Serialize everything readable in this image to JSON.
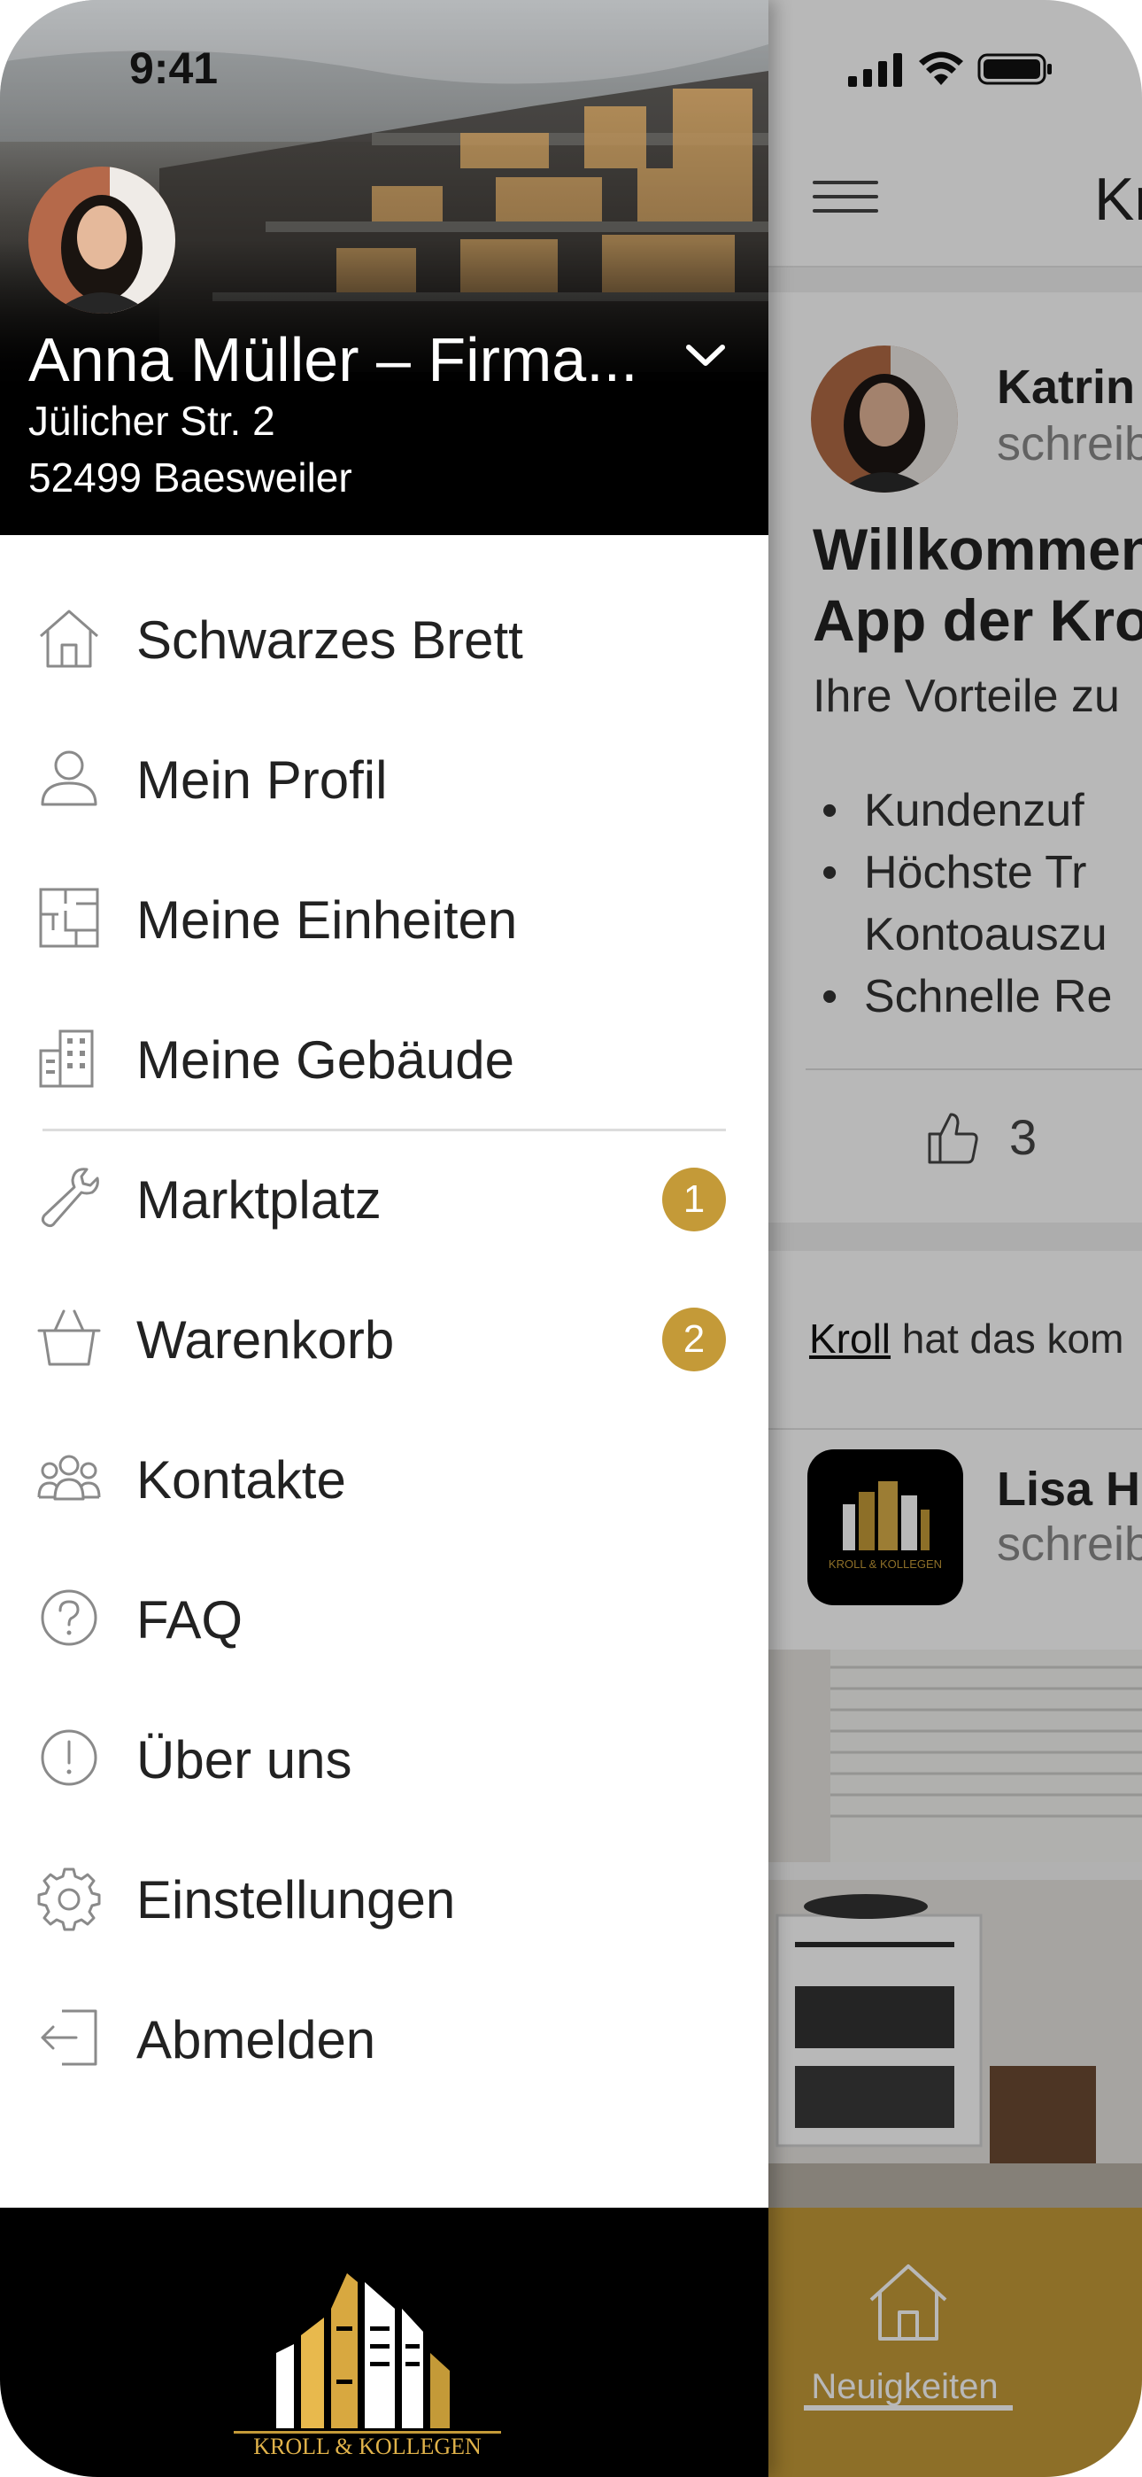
{
  "status_bar": {
    "time": "9:41"
  },
  "profile": {
    "name": "Anna Müller – Firma...",
    "street": "Jülicher Str. 2",
    "city": "52499 Baesweiler"
  },
  "menu": {
    "items": [
      {
        "label": "Schwarzes Brett",
        "icon": "house-icon"
      },
      {
        "label": "Mein Profil",
        "icon": "person-icon"
      },
      {
        "label": "Meine Einheiten",
        "icon": "floorplan-icon"
      },
      {
        "label": "Meine Gebäude",
        "icon": "building-icon"
      },
      {
        "label": "Marktplatz",
        "icon": "wrench-icon",
        "badge": "1"
      },
      {
        "label": "Warenkorb",
        "icon": "basket-icon",
        "badge": "2"
      },
      {
        "label": "Kontakte",
        "icon": "group-icon"
      },
      {
        "label": "FAQ",
        "icon": "question-icon"
      },
      {
        "label": "Über uns",
        "icon": "info-icon"
      },
      {
        "label": "Einstellungen",
        "icon": "gear-icon"
      },
      {
        "label": "Abmelden",
        "icon": "logout-icon"
      }
    ]
  },
  "footer": {
    "logo_text": "KROLL & KOLLEGEN"
  },
  "background_page": {
    "header_title": "Kr",
    "post1": {
      "author": "Katrin",
      "author_sub": "schreib",
      "title_line1": "Willkommen",
      "title_line2": "App der Kro",
      "subtitle": "Ihre Vorteile zu",
      "bullet1": "Kundenzuf",
      "bullet2_line1": "Höchste Tr",
      "bullet2_line2": "Kontoauszu",
      "bullet3": "Schnelle Re",
      "likes": "3"
    },
    "notice_link": "Kroll",
    "notice_text": " hat das kom",
    "post2": {
      "author": "Lisa H",
      "author_sub": "schreib",
      "logo_text": "KROLL & KOLLEGEN"
    },
    "tab_label": "Neuigkeiten"
  },
  "colors": {
    "accent": "#c49a38",
    "footer_bg": "#000000"
  }
}
